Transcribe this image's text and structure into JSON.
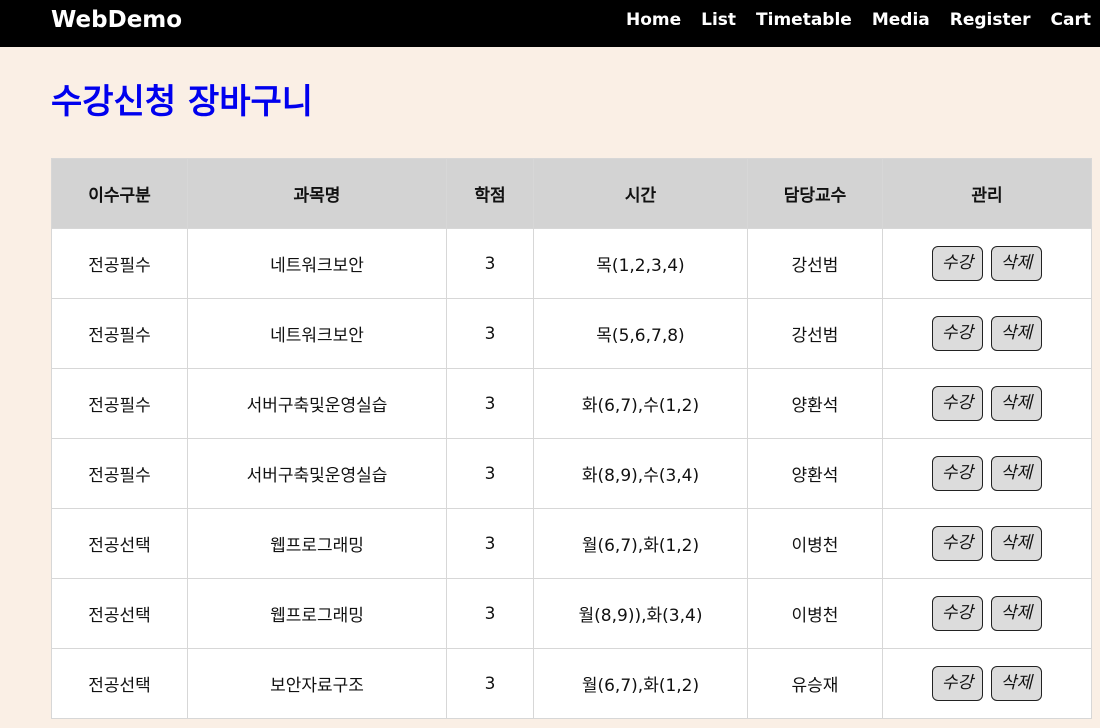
{
  "navbar": {
    "brand": "WebDemo",
    "links": [
      "Home",
      "List",
      "Timetable",
      "Media",
      "Register",
      "Cart"
    ]
  },
  "page": {
    "title": "수강신청 장바구니"
  },
  "colors": {
    "navbar_bg": "#000000",
    "page_bg": "#faefe5",
    "title": "#0000ee",
    "table_header_bg": "#d3d3d3",
    "button_bg": "#dcdcdc"
  },
  "table": {
    "headers": [
      "이수구분",
      "과목명",
      "학점",
      "시간",
      "담당교수",
      "관리"
    ],
    "rows": [
      {
        "category": "전공필수",
        "course": "네트워크보안",
        "credits": "3",
        "time": "목(1,2,3,4)",
        "professor": "강선범",
        "enroll": "수강",
        "delete": "삭제"
      },
      {
        "category": "전공필수",
        "course": "네트워크보안",
        "credits": "3",
        "time": "목(5,6,7,8)",
        "professor": "강선범",
        "enroll": "수강",
        "delete": "삭제"
      },
      {
        "category": "전공필수",
        "course": "서버구축및운영실습",
        "credits": "3",
        "time": "화(6,7),수(1,2)",
        "professor": "양환석",
        "enroll": "수강",
        "delete": "삭제"
      },
      {
        "category": "전공필수",
        "course": "서버구축및운영실습",
        "credits": "3",
        "time": "화(8,9),수(3,4)",
        "professor": "양환석",
        "enroll": "수강",
        "delete": "삭제"
      },
      {
        "category": "전공선택",
        "course": "웹프로그래밍",
        "credits": "3",
        "time": "월(6,7),화(1,2)",
        "professor": "이병천",
        "enroll": "수강",
        "delete": "삭제"
      },
      {
        "category": "전공선택",
        "course": "웹프로그래밍",
        "credits": "3",
        "time": "월(8,9)),화(3,4)",
        "professor": "이병천",
        "enroll": "수강",
        "delete": "삭제"
      },
      {
        "category": "전공선택",
        "course": "보안자료구조",
        "credits": "3",
        "time": "월(6,7),화(1,2)",
        "professor": "유승재",
        "enroll": "수강",
        "delete": "삭제"
      }
    ]
  }
}
